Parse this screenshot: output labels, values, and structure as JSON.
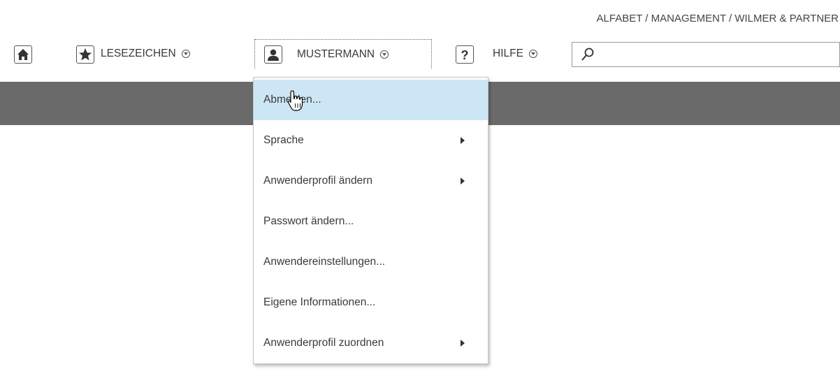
{
  "breadcrumb": "ALFABET / MANAGEMENT / WILMER & PARTNER",
  "toolbar": {
    "home_icon": "home-icon",
    "bookmarks": {
      "icon": "star-icon",
      "label": "LESEZEICHEN"
    },
    "user": {
      "icon": "user-icon",
      "label": "MUSTERMANN"
    },
    "help": {
      "icon": "question-icon",
      "label": "HILFE"
    },
    "search": {
      "icon": "search-icon",
      "value": ""
    }
  },
  "dropdown": {
    "items": [
      {
        "label": "Abmelden...",
        "submenu": false,
        "active": true
      },
      {
        "label": "Sprache",
        "submenu": true
      },
      {
        "label": "Anwenderprofil ändern",
        "submenu": true
      },
      {
        "label": "Passwort ändern...",
        "submenu": false
      },
      {
        "label": "Anwendereinstellungen...",
        "submenu": false
      },
      {
        "label": "Eigene Informationen...",
        "submenu": false
      },
      {
        "label": "Anwenderprofil zuordnen",
        "submenu": true
      }
    ]
  },
  "colors": {
    "header_bar": "#6a6a6a",
    "active_item": "#cde6f5"
  }
}
